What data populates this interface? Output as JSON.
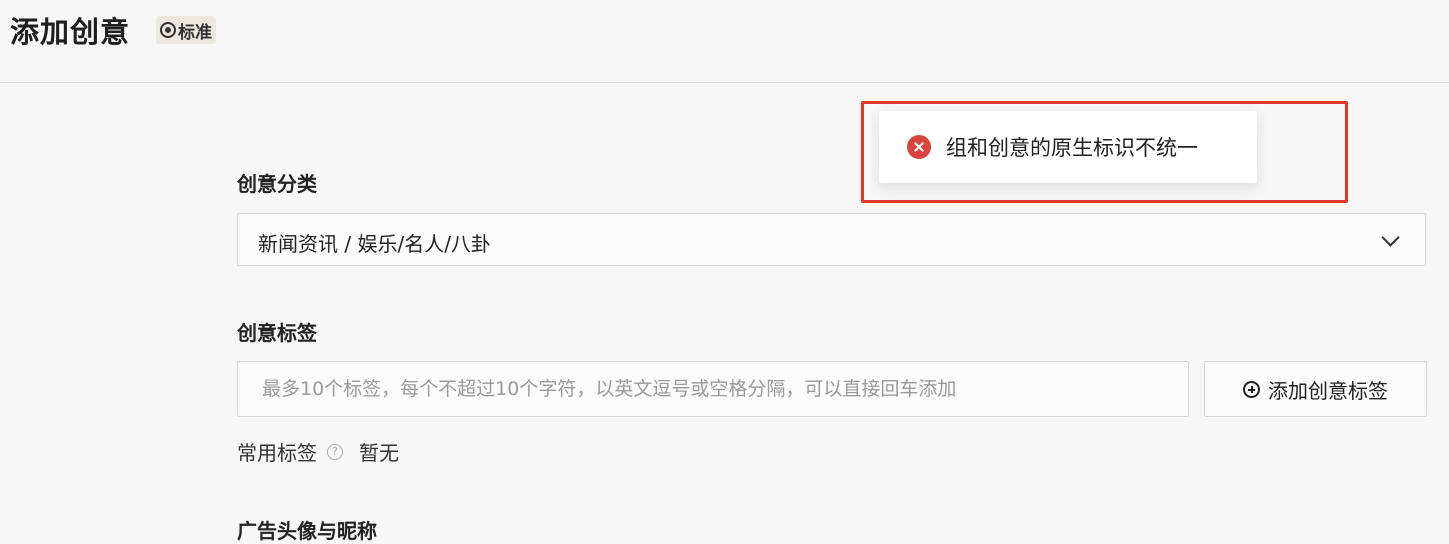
{
  "header": {
    "title": "添加创意",
    "badge_label": "标准",
    "badge_icon": "target-icon"
  },
  "form": {
    "category": {
      "label": "创意分类",
      "value": "新闻资讯 / 娱乐/名人/八卦",
      "icon": "chevron-down-icon"
    },
    "tags": {
      "label": "创意标签",
      "placeholder": "最多10个标签，每个不超过10个字符，以英文逗号或空格分隔，可以直接回车添加",
      "add_button_label": "添加创意标签",
      "add_button_icon": "plus-circle-icon"
    },
    "common_tags": {
      "label": "常用标签",
      "help_icon": "question-circle-icon",
      "value": "暂无"
    },
    "avatar_nickname": {
      "label": "广告头像与昵称"
    }
  },
  "toast": {
    "message": "组和创意的原生标识不统一",
    "icon": "error-circle-icon",
    "highlight_color": "#e0392c",
    "icon_color": "#d9453c"
  }
}
